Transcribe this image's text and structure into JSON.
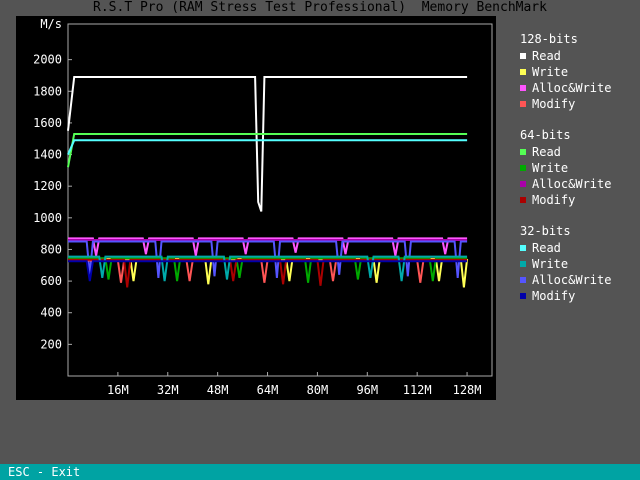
{
  "window": {
    "title": "R.S.T Pro (RAM Stress Test Professional)  Memory BenchMark"
  },
  "footer": {
    "exit_hint": "ESC - Exit"
  },
  "legend": {
    "groups": [
      {
        "title": "128-bits",
        "items": [
          {
            "label": "Read",
            "color": "#ffffff"
          },
          {
            "label": "Write",
            "color": "#ffff55"
          },
          {
            "label": "Alloc&Write",
            "color": "#ff55ff"
          },
          {
            "label": "Modify",
            "color": "#ff5555"
          }
        ]
      },
      {
        "title": "64-bits",
        "items": [
          {
            "label": "Read",
            "color": "#55ff55"
          },
          {
            "label": "Write",
            "color": "#00aa00"
          },
          {
            "label": "Alloc&Write",
            "color": "#aa00aa"
          },
          {
            "label": "Modify",
            "color": "#aa0000"
          }
        ]
      },
      {
        "title": "32-bits",
        "items": [
          {
            "label": "Read",
            "color": "#55ffff"
          },
          {
            "label": "Write",
            "color": "#00aaaa"
          },
          {
            "label": "Alloc&Write",
            "color": "#5555ff"
          },
          {
            "label": "Modify",
            "color": "#0000aa"
          }
        ]
      }
    ]
  },
  "chart_data": {
    "type": "line",
    "ylabel": "M/s",
    "xlabel": "",
    "xlim": [
      0,
      136
    ],
    "ylim": [
      0,
      2200
    ],
    "xticks": [
      16,
      32,
      48,
      64,
      80,
      96,
      112,
      128
    ],
    "xtick_labels": [
      "16M",
      "32M",
      "48M",
      "64M",
      "80M",
      "96M",
      "112M",
      "128M"
    ],
    "yticks": [
      200,
      400,
      600,
      800,
      1000,
      1200,
      1400,
      1600,
      1800,
      2000
    ],
    "ytick_labels": [
      "200",
      "400",
      "600",
      "800",
      "1000",
      "1200",
      "1400",
      "1600",
      "1800",
      "2000"
    ],
    "series": [
      {
        "name": "128-bits Read",
        "color": "#ffffff",
        "x": [
          0,
          2,
          4,
          60,
          61,
          62,
          63,
          64,
          128
        ],
        "y": [
          1550,
          1890,
          1890,
          1890,
          1100,
          1040,
          1890,
          1890,
          1890
        ]
      },
      {
        "name": "64-bits Read",
        "color": "#55ff55",
        "x": [
          0,
          2,
          4,
          128
        ],
        "y": [
          1320,
          1530,
          1530,
          1530
        ]
      },
      {
        "name": "32-bits Read",
        "color": "#55ffff",
        "x": [
          0,
          2,
          4,
          128
        ],
        "y": [
          1400,
          1490,
          1490,
          1490
        ]
      },
      {
        "name": "128-bits Alloc&Write",
        "color": "#ff55ff",
        "x": [
          0,
          8,
          9,
          10,
          24,
          25,
          26,
          40,
          41,
          42,
          56,
          57,
          58,
          72,
          73,
          74,
          88,
          89,
          90,
          104,
          105,
          106,
          120,
          121,
          122,
          128
        ],
        "y": [
          870,
          870,
          760,
          870,
          870,
          770,
          870,
          870,
          760,
          870,
          870,
          770,
          870,
          870,
          780,
          870,
          870,
          770,
          870,
          870,
          760,
          870,
          870,
          770,
          870,
          870
        ]
      },
      {
        "name": "64-bits Alloc&Write",
        "color": "#aa00aa",
        "x": [
          0,
          128
        ],
        "y": [
          860,
          860
        ]
      },
      {
        "name": "32-bits Alloc&Write",
        "color": "#5555ff",
        "x": [
          0,
          6,
          7,
          8,
          28,
          29,
          30,
          46,
          47,
          48,
          66,
          67,
          68,
          86,
          87,
          88,
          108,
          109,
          110,
          124,
          125,
          126,
          128
        ],
        "y": [
          850,
          850,
          640,
          850,
          850,
          620,
          850,
          850,
          630,
          850,
          850,
          620,
          850,
          850,
          640,
          850,
          850,
          630,
          850,
          850,
          620,
          850,
          850
        ]
      },
      {
        "name": "128-bits Write",
        "color": "#ffff55",
        "x": [
          0,
          20,
          21,
          22,
          44,
          45,
          46,
          70,
          71,
          72,
          98,
          99,
          100,
          118,
          119,
          120,
          126,
          127,
          128
        ],
        "y": [
          740,
          740,
          600,
          740,
          740,
          580,
          740,
          740,
          600,
          740,
          740,
          590,
          740,
          740,
          600,
          740,
          740,
          560,
          740
        ]
      },
      {
        "name": "128-bits Modify",
        "color": "#ff5555",
        "x": [
          0,
          16,
          17,
          18,
          38,
          39,
          40,
          62,
          63,
          64,
          84,
          85,
          86,
          112,
          113,
          114,
          128
        ],
        "y": [
          730,
          730,
          590,
          730,
          730,
          600,
          730,
          730,
          590,
          730,
          730,
          600,
          730,
          730,
          590,
          730,
          730
        ]
      },
      {
        "name": "64-bits Write",
        "color": "#00aa00",
        "x": [
          0,
          12,
          13,
          14,
          34,
          35,
          36,
          54,
          55,
          56,
          76,
          77,
          78,
          92,
          93,
          94,
          116,
          117,
          118,
          128
        ],
        "y": [
          745,
          745,
          610,
          745,
          745,
          600,
          745,
          745,
          620,
          745,
          745,
          590,
          745,
          745,
          610,
          745,
          745,
          600,
          745,
          745
        ]
      },
      {
        "name": "64-bits Modify",
        "color": "#aa0000",
        "x": [
          0,
          18,
          19,
          20,
          52,
          53,
          54,
          68,
          69,
          70,
          80,
          81,
          82,
          128
        ],
        "y": [
          735,
          735,
          560,
          735,
          735,
          600,
          735,
          735,
          580,
          735,
          735,
          570,
          735,
          735
        ]
      },
      {
        "name": "32-bits Write",
        "color": "#00aaaa",
        "x": [
          0,
          10,
          11,
          12,
          30,
          31,
          32,
          50,
          51,
          52,
          96,
          97,
          98,
          106,
          107,
          108,
          128
        ],
        "y": [
          755,
          755,
          620,
          755,
          755,
          600,
          755,
          755,
          610,
          755,
          755,
          620,
          755,
          755,
          600,
          755,
          755
        ]
      },
      {
        "name": "32-bits Modify",
        "color": "#0000aa",
        "x": [
          0,
          6,
          7,
          8,
          128
        ],
        "y": [
          725,
          725,
          600,
          725,
          725
        ]
      }
    ]
  }
}
